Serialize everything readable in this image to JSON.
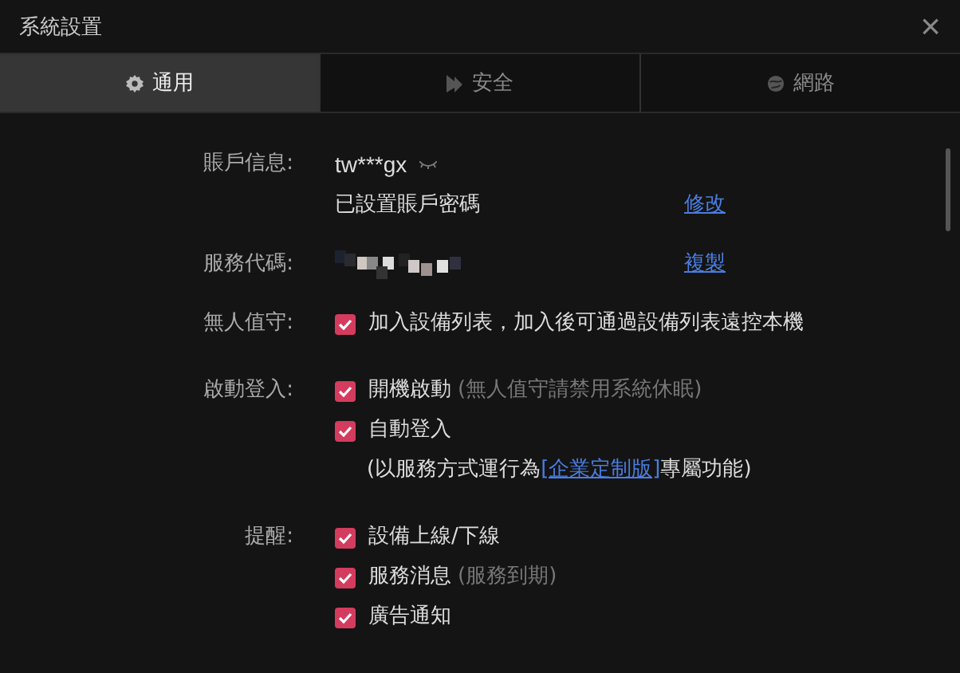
{
  "window": {
    "title": "系統設置",
    "close": "×"
  },
  "tabs": [
    {
      "label": "通用",
      "selected": true
    },
    {
      "label": "安全",
      "selected": false
    },
    {
      "label": "網路",
      "selected": false
    }
  ],
  "account": {
    "label": "賬戶信息:",
    "username": "tw***gx",
    "password_status": "已設置賬戶密碼",
    "change_link": "修改"
  },
  "service_code": {
    "label": "服務代碼:",
    "copy_link": "複製"
  },
  "sections": [
    {
      "label": "無人值守:",
      "options": [
        {
          "text": "加入設備列表，加入後可通過設備列表遠控本機",
          "checked": true
        }
      ]
    },
    {
      "label": "啟動登入:",
      "options": [
        {
          "text": "開機啟動",
          "hint": "(無人值守請禁用系統休眠)",
          "checked": true
        },
        {
          "text": "自動登入",
          "checked": true,
          "note": {
            "before": "(以服務方式運行為",
            "link": "[企業定制版]",
            "after": "專屬功能)"
          }
        }
      ]
    },
    {
      "label": "提醒:",
      "options": [
        {
          "text": "設備上線/下線",
          "checked": true
        },
        {
          "text": "服務消息",
          "hint": "(服務到期)",
          "checked": true
        },
        {
          "text": "廣告通知",
          "checked": true
        }
      ]
    }
  ]
}
